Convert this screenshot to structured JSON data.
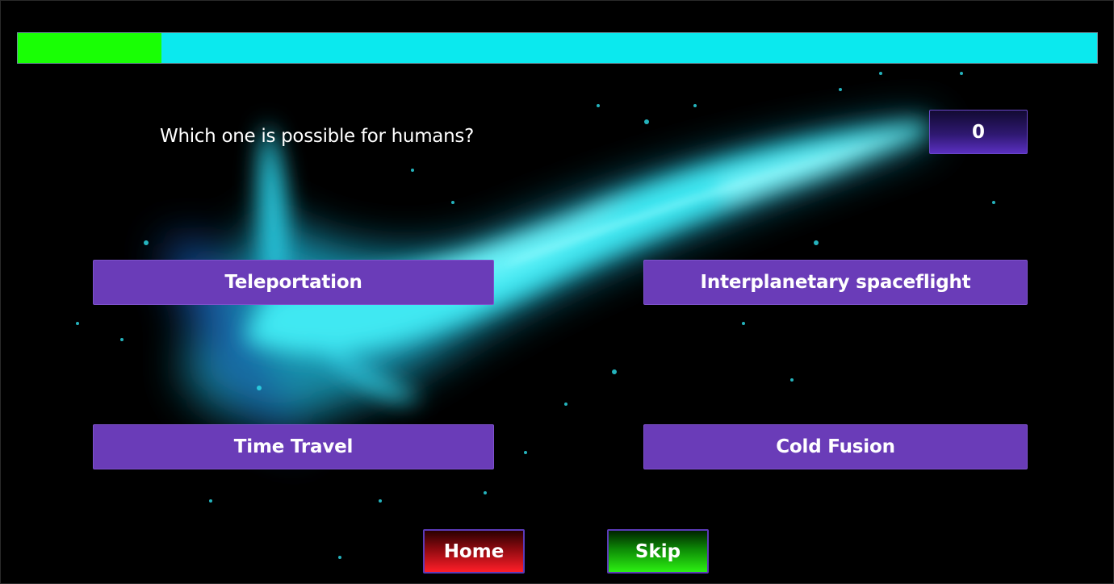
{
  "progress": {
    "fraction": 0.133,
    "fill_color": "#19ff05",
    "track_color": "#0be9ee"
  },
  "question": {
    "text": "Which one is possible for humans?"
  },
  "score": {
    "value": "0"
  },
  "answers": [
    {
      "label": "Teleportation"
    },
    {
      "label": "Interplanetary spaceflight"
    },
    {
      "label": "Time Travel"
    },
    {
      "label": "Cold Fusion"
    }
  ],
  "nav": {
    "home_label": "Home",
    "skip_label": "Skip"
  },
  "background": {
    "image": "cyan-nebula-background",
    "accent_color": "#3ff4f6"
  }
}
